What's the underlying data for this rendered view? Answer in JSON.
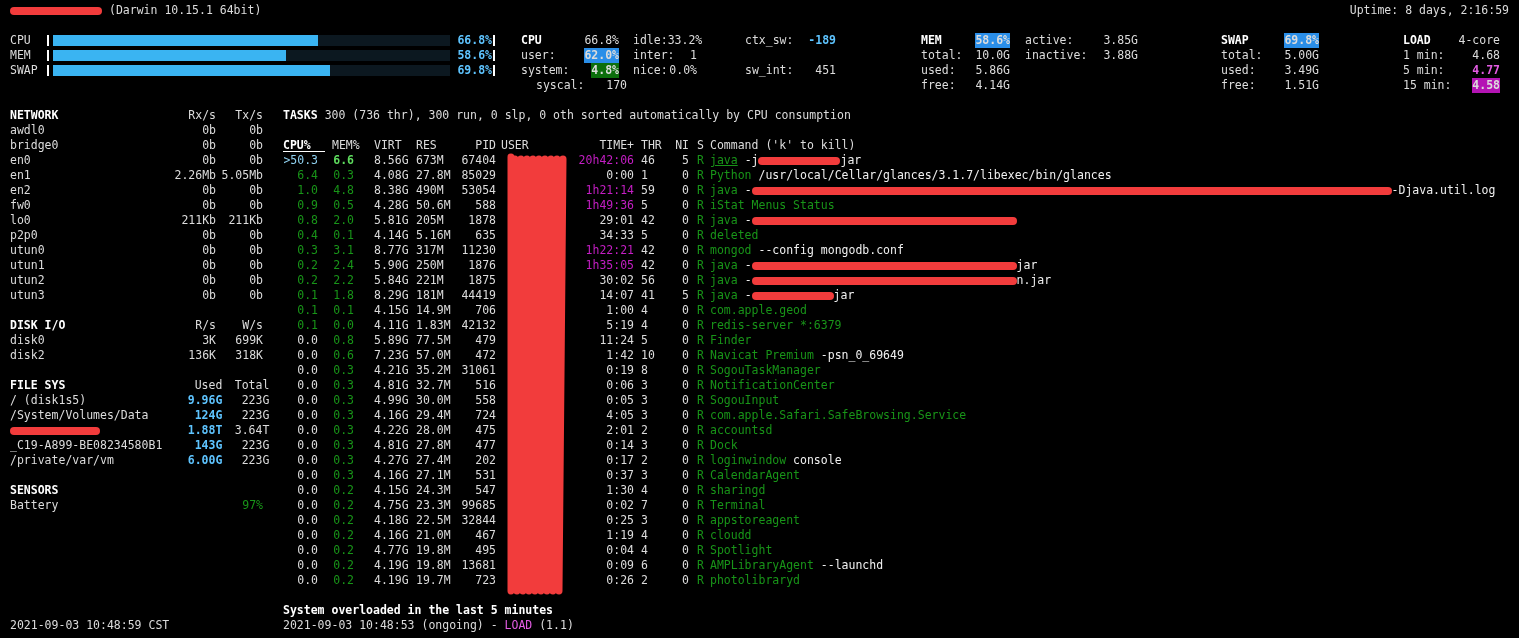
{
  "header": {
    "host_redacted": true,
    "system": "(Darwin 10.15.1 64bit)",
    "uptime": "Uptime: 8 days, 2:16:59"
  },
  "meters": [
    {
      "label": "CPU",
      "level": 0.668,
      "percent": "66.8%"
    },
    {
      "label": "MEM",
      "level": 0.586,
      "percent": "58.6%"
    },
    {
      "label": "SWAP",
      "level": 0.698,
      "percent": "69.8%"
    }
  ],
  "stat_blocks": [
    {
      "kind": "cpu",
      "columns": [
        [
          {
            "label": "CPU",
            "value": "66.8%",
            "title": true,
            "color": "#dcdcdc",
            "filled": false,
            "bold": false
          },
          {
            "label": "user:",
            "value": "62.0%",
            "title": false,
            "color": "#2a8ee8",
            "filled": true,
            "bold": true
          },
          {
            "label": "system:",
            "value": "4.8%",
            "title": false,
            "color": "#0c6e0c",
            "filled": true,
            "bold": true
          }
        ],
        [
          {
            "label": "idle:",
            "value": "33.2%",
            "title": false,
            "color": "#dcdcdc",
            "filled": false,
            "bold": false
          },
          {
            "label": "inter:",
            "value": "1",
            "title": false,
            "color": "#dcdcdc",
            "filled": false,
            "bold": false
          },
          {
            "label": "nice:",
            "value": "0.0%",
            "title": false,
            "color": "#dcdcdc",
            "filled": false,
            "bold": false
          }
        ],
        [
          {
            "label": "ctx_sw:",
            "value": "-189",
            "title": false,
            "color": "#5ec4ff",
            "filled": false,
            "bold": true
          },
          null,
          {
            "label": "sw_int:",
            "value": "451",
            "title": false,
            "color": "#dcdcdc",
            "filled": false,
            "bold": false
          }
        ]
      ],
      "extra": {
        "label": "syscal:",
        "value": "170"
      }
    },
    {
      "kind": "mem",
      "columns": [
        [
          {
            "label": "MEM",
            "value": "58.6%",
            "title": true,
            "color": "#2a8ee8",
            "filled": true,
            "bold": true
          },
          {
            "label": "total:",
            "value": "10.0G",
            "title": false,
            "color": "#dcdcdc",
            "filled": false,
            "bold": false
          },
          {
            "label": "used:",
            "value": "5.86G",
            "title": false,
            "color": "#dcdcdc",
            "filled": false,
            "bold": false
          },
          {
            "label": "free:",
            "value": "4.14G",
            "title": false,
            "color": "#dcdcdc",
            "filled": false,
            "bold": false
          }
        ],
        [
          {
            "label": "active:",
            "value": "3.85G",
            "title": false,
            "color": "#dcdcdc",
            "filled": false,
            "bold": false
          },
          {
            "label": "inactive:",
            "value": "3.88G",
            "title": false,
            "color": "#dcdcdc",
            "filled": false,
            "bold": false
          }
        ]
      ]
    },
    {
      "kind": "swap",
      "columns": [
        [
          {
            "label": "SWAP",
            "value": "69.8%",
            "title": true,
            "color": "#2a8ee8",
            "filled": true,
            "bold": true
          },
          {
            "label": "total:",
            "value": "5.00G",
            "title": false,
            "color": "#dcdcdc",
            "filled": false,
            "bold": false
          },
          {
            "label": "used:",
            "value": "3.49G",
            "title": false,
            "color": "#dcdcdc",
            "filled": false,
            "bold": false
          },
          {
            "label": "free:",
            "value": "1.51G",
            "title": false,
            "color": "#dcdcdc",
            "filled": false,
            "bold": false
          }
        ]
      ]
    },
    {
      "kind": "load",
      "columns": [
        [
          {
            "label": "LOAD",
            "value": "4-core",
            "title": true,
            "color": "#dcdcdc",
            "filled": false,
            "bold": false
          },
          {
            "label": "1 min:",
            "value": "4.68",
            "title": false,
            "color": "#dcdcdc",
            "filled": false,
            "bold": false
          },
          {
            "label": "5 min:",
            "value": "4.77",
            "title": false,
            "color": "#e35ce3",
            "filled": false,
            "bold": true
          },
          {
            "label": "15 min:",
            "value": "4.58",
            "title": false,
            "color": "#b414b4",
            "filled": true,
            "bold": true
          }
        ]
      ]
    }
  ],
  "panels": [
    {
      "title": "NETWORK",
      "headers": [
        "Rx/s",
        "Tx/s"
      ],
      "rows": [
        {
          "name": "awdl0",
          "values": [
            {
              "text": "0b",
              "color": "#dcdcdc",
              "bold": false
            },
            {
              "text": "0b",
              "color": "#dcdcdc",
              "bold": false
            }
          ]
        },
        {
          "name": "bridge0",
          "values": [
            {
              "text": "0b",
              "color": "#dcdcdc",
              "bold": false
            },
            {
              "text": "0b",
              "color": "#dcdcdc",
              "bold": false
            }
          ]
        },
        {
          "name": "en0",
          "values": [
            {
              "text": "0b",
              "color": "#dcdcdc",
              "bold": false
            },
            {
              "text": "0b",
              "color": "#dcdcdc",
              "bold": false
            }
          ]
        },
        {
          "name": "en1",
          "values": [
            {
              "text": "2.26Mb",
              "color": "#dcdcdc",
              "bold": false
            },
            {
              "text": "5.05Mb",
              "color": "#dcdcdc",
              "bold": false
            }
          ]
        },
        {
          "name": "en2",
          "values": [
            {
              "text": "0b",
              "color": "#dcdcdc",
              "bold": false
            },
            {
              "text": "0b",
              "color": "#dcdcdc",
              "bold": false
            }
          ]
        },
        {
          "name": "fw0",
          "values": [
            {
              "text": "0b",
              "color": "#dcdcdc",
              "bold": false
            },
            {
              "text": "0b",
              "color": "#dcdcdc",
              "bold": false
            }
          ]
        },
        {
          "name": "lo0",
          "values": [
            {
              "text": "211Kb",
              "color": "#dcdcdc",
              "bold": false
            },
            {
              "text": "211Kb",
              "color": "#dcdcdc",
              "bold": false
            }
          ]
        },
        {
          "name": "p2p0",
          "values": [
            {
              "text": "0b",
              "color": "#dcdcdc",
              "bold": false
            },
            {
              "text": "0b",
              "color": "#dcdcdc",
              "bold": false
            }
          ]
        },
        {
          "name": "utun0",
          "values": [
            {
              "text": "0b",
              "color": "#dcdcdc",
              "bold": false
            },
            {
              "text": "0b",
              "color": "#dcdcdc",
              "bold": false
            }
          ]
        },
        {
          "name": "utun1",
          "values": [
            {
              "text": "0b",
              "color": "#dcdcdc",
              "bold": false
            },
            {
              "text": "0b",
              "color": "#dcdcdc",
              "bold": false
            }
          ]
        },
        {
          "name": "utun2",
          "values": [
            {
              "text": "0b",
              "color": "#dcdcdc",
              "bold": false
            },
            {
              "text": "0b",
              "color": "#dcdcdc",
              "bold": false
            }
          ]
        },
        {
          "name": "utun3",
          "values": [
            {
              "text": "0b",
              "color": "#dcdcdc",
              "bold": false
            },
            {
              "text": "0b",
              "color": "#dcdcdc",
              "bold": false
            }
          ]
        }
      ]
    },
    {
      "title": "DISK I/O",
      "headers": [
        "R/s",
        "W/s"
      ],
      "rows": [
        {
          "name": "disk0",
          "values": [
            {
              "text": "3K",
              "color": "#dcdcdc",
              "bold": false
            },
            {
              "text": "699K",
              "color": "#dcdcdc",
              "bold": false
            }
          ]
        },
        {
          "name": "disk2",
          "values": [
            {
              "text": "136K",
              "color": "#dcdcdc",
              "bold": false
            },
            {
              "text": "318K",
              "color": "#dcdcdc",
              "bold": false
            }
          ]
        }
      ]
    },
    {
      "title": "FILE SYS",
      "headers": [
        "Used",
        "Total"
      ],
      "rows": [
        {
          "name": "/ (disk1s5)",
          "values": [
            {
              "text": "9.96G",
              "color": "#5ec4ff",
              "bold": true
            },
            {
              "text": "223G",
              "color": "#dcdcdc",
              "bold": false
            }
          ]
        },
        {
          "name": "/System/Volumes/Data",
          "values": [
            {
              "text": "124G",
              "color": "#5ec4ff",
              "bold": true
            },
            {
              "text": "223G",
              "color": "#dcdcdc",
              "bold": false
            }
          ]
        },
        {
          "redacted": true,
          "values": [
            {
              "text": "1.88T",
              "color": "#5ec4ff",
              "bold": true
            },
            {
              "text": "3.64T",
              "color": "#dcdcdc",
              "bold": false
            }
          ]
        },
        {
          "name": "_C19-A899-BE08234580B1",
          "values": [
            {
              "text": "143G",
              "color": "#5ec4ff",
              "bold": true
            },
            {
              "text": "223G",
              "color": "#dcdcdc",
              "bold": false
            }
          ]
        },
        {
          "name": "/private/var/vm",
          "values": [
            {
              "text": "6.00G",
              "color": "#5ec4ff",
              "bold": true
            },
            {
              "text": "223G",
              "color": "#dcdcdc",
              "bold": false
            }
          ]
        }
      ]
    },
    {
      "title": "SENSORS",
      "rows": [
        {
          "name": "Battery",
          "values": [
            {
              "text": "97%",
              "color": "#189418",
              "bold": false
            }
          ]
        }
      ]
    }
  ],
  "footer_time": "2021-09-03 10:48:59 CST",
  "tasks": {
    "title": "TASKS",
    "summary": "300 (736 thr), 300 run, 0 slp, 0 oth sorted automatically by CPU consumption"
  },
  "process_table": {
    "user_redacted": true,
    "columns": [
      {
        "label": "CPU%",
        "sorted": true
      },
      {
        "label": "MEM%",
        "sorted": false
      },
      {
        "label": "VIRT",
        "sorted": false
      },
      {
        "label": "RES",
        "sorted": false
      },
      {
        "label": "PID",
        "sorted": false
      },
      {
        "label": "USER",
        "sorted": false
      },
      {
        "label": "TIME+",
        "sorted": false
      },
      {
        "label": "THR",
        "sorted": false
      },
      {
        "label": "NI",
        "sorted": false
      },
      {
        "label": "S",
        "sorted": false
      },
      {
        "label": "Command ('k' to kill)",
        "sorted": false
      }
    ],
    "rows": [
      {
        "selected": true,
        "cpu": {
          "text": ">50.3",
          "color": "#8fd0ef"
        },
        "mem": {
          "text": "6.6",
          "color": "#5edc5e",
          "bold": true
        },
        "virt": "8.56G",
        "res": "673M",
        "pid": "67404",
        "time": {
          "text": "20h42:06",
          "color": "#c41ec4"
        },
        "thr": "46",
        "ni": "5",
        "status": "R",
        "command": [
          {
            "kind": "name",
            "text": "java"
          },
          {
            "kind": "args",
            "text": "-j"
          },
          {
            "kind": "blot"
          },
          {
            "kind": "tail",
            "text": "jar"
          }
        ]
      },
      {
        "selected": false,
        "cpu": {
          "text": "6.4",
          "color": "#189418"
        },
        "mem": {
          "text": "0.3",
          "color": "#189418",
          "bold": false
        },
        "virt": "4.08G",
        "res": "27.8M",
        "pid": "85029",
        "time": {
          "text": "0:00",
          "color": "#dcdcdc"
        },
        "thr": "1",
        "ni": "0",
        "status": "R",
        "command": [
          {
            "kind": "name",
            "text": "Python"
          },
          {
            "kind": "args",
            "text": "/usr/local/Cellar/glances/3.1.7/libexec/bin/glances"
          }
        ]
      },
      {
        "selected": false,
        "cpu": {
          "text": "1.0",
          "color": "#189418"
        },
        "mem": {
          "text": "4.8",
          "color": "#189418",
          "bold": false
        },
        "virt": "8.38G",
        "res": "490M",
        "pid": "53054",
        "time": {
          "text": "1h21:14",
          "color": "#c41ec4"
        },
        "thr": "59",
        "ni": "0",
        "status": "R",
        "command": [
          {
            "kind": "name",
            "text": "java"
          },
          {
            "kind": "args",
            "text": "-"
          },
          {
            "kind": "strike"
          },
          {
            "kind": "tail",
            "text": "-Djava.util.log"
          }
        ]
      },
      {
        "selected": false,
        "cpu": {
          "text": "0.9",
          "color": "#189418"
        },
        "mem": {
          "text": "0.5",
          "color": "#189418",
          "bold": false
        },
        "virt": "4.28G",
        "res": "50.6M",
        "pid": "588",
        "time": {
          "text": "1h49:36",
          "color": "#c41ec4"
        },
        "thr": "5",
        "ni": "0",
        "status": "R",
        "command": [
          {
            "kind": "name",
            "text": "iStat Menus Status"
          }
        ]
      },
      {
        "selected": false,
        "cpu": {
          "text": "0.8",
          "color": "#189418"
        },
        "mem": {
          "text": "2.0",
          "color": "#189418",
          "bold": false
        },
        "virt": "5.81G",
        "res": "205M",
        "pid": "1878",
        "time": {
          "text": "29:01",
          "color": "#dcdcdc"
        },
        "thr": "42",
        "ni": "0",
        "status": "R",
        "command": [
          {
            "kind": "name",
            "text": "java"
          },
          {
            "kind": "args",
            "text": "-"
          },
          {
            "kind": "smear"
          }
        ]
      },
      {
        "selected": false,
        "cpu": {
          "text": "0.4",
          "color": "#189418"
        },
        "mem": {
          "text": "0.1",
          "color": "#189418",
          "bold": false
        },
        "virt": "4.14G",
        "res": "5.16M",
        "pid": "635",
        "time": {
          "text": "34:33",
          "color": "#dcdcdc"
        },
        "thr": "5",
        "ni": "0",
        "status": "R",
        "command": [
          {
            "kind": "name",
            "text": "deleted"
          }
        ]
      },
      {
        "selected": false,
        "cpu": {
          "text": "0.3",
          "color": "#189418"
        },
        "mem": {
          "text": "3.1",
          "color": "#189418",
          "bold": false
        },
        "virt": "8.77G",
        "res": "317M",
        "pid": "11230",
        "time": {
          "text": "1h22:21",
          "color": "#c41ec4"
        },
        "thr": "42",
        "ni": "0",
        "status": "R",
        "command": [
          {
            "kind": "name",
            "text": "mongod"
          },
          {
            "kind": "args",
            "text": "--config mongodb.conf"
          }
        ]
      },
      {
        "selected": false,
        "cpu": {
          "text": "0.2",
          "color": "#189418"
        },
        "mem": {
          "text": "2.4",
          "color": "#189418",
          "bold": false
        },
        "virt": "5.90G",
        "res": "250M",
        "pid": "1876",
        "time": {
          "text": "1h35:05",
          "color": "#c41ec4"
        },
        "thr": "42",
        "ni": "0",
        "status": "R",
        "command": [
          {
            "kind": "name",
            "text": "java"
          },
          {
            "kind": "args",
            "text": "-"
          },
          {
            "kind": "smear"
          },
          {
            "kind": "tail",
            "text": "jar"
          }
        ]
      },
      {
        "selected": false,
        "cpu": {
          "text": "0.2",
          "color": "#189418"
        },
        "mem": {
          "text": "2.2",
          "color": "#189418",
          "bold": false
        },
        "virt": "5.84G",
        "res": "221M",
        "pid": "1875",
        "time": {
          "text": "30:02",
          "color": "#dcdcdc"
        },
        "thr": "56",
        "ni": "0",
        "status": "R",
        "command": [
          {
            "kind": "name",
            "text": "java"
          },
          {
            "kind": "args",
            "text": "-"
          },
          {
            "kind": "smear"
          },
          {
            "kind": "tail",
            "text": "n.jar"
          }
        ]
      },
      {
        "selected": false,
        "cpu": {
          "text": "0.1",
          "color": "#189418"
        },
        "mem": {
          "text": "1.8",
          "color": "#189418",
          "bold": false
        },
        "virt": "8.29G",
        "res": "181M",
        "pid": "44419",
        "time": {
          "text": "14:07",
          "color": "#dcdcdc"
        },
        "thr": "41",
        "ni": "5",
        "status": "R",
        "command": [
          {
            "kind": "name",
            "text": "java"
          },
          {
            "kind": "args",
            "text": "-"
          },
          {
            "kind": "blot"
          },
          {
            "kind": "tail",
            "text": "jar"
          }
        ]
      },
      {
        "selected": false,
        "cpu": {
          "text": "0.1",
          "color": "#189418"
        },
        "mem": {
          "text": "0.1",
          "color": "#189418",
          "bold": false
        },
        "virt": "4.15G",
        "res": "14.9M",
        "pid": "706",
        "time": {
          "text": "1:00",
          "color": "#dcdcdc"
        },
        "thr": "4",
        "ni": "0",
        "status": "R",
        "command": [
          {
            "kind": "name",
            "text": "com.apple.geod"
          }
        ]
      },
      {
        "selected": false,
        "cpu": {
          "text": "0.1",
          "color": "#189418"
        },
        "mem": {
          "text": "0.0",
          "color": "#189418",
          "bold": false
        },
        "virt": "4.11G",
        "res": "1.83M",
        "pid": "42132",
        "time": {
          "text": "5:19",
          "color": "#dcdcdc"
        },
        "thr": "4",
        "ni": "0",
        "status": "R",
        "command": [
          {
            "kind": "name",
            "text": "redis-server *:6379"
          }
        ]
      },
      {
        "selected": false,
        "cpu": {
          "text": "0.0",
          "color": "#dcdcdc"
        },
        "mem": {
          "text": "0.8",
          "color": "#189418",
          "bold": false
        },
        "virt": "5.89G",
        "res": "77.5M",
        "pid": "479",
        "time": {
          "text": "11:24",
          "color": "#dcdcdc"
        },
        "thr": "5",
        "ni": "0",
        "status": "R",
        "command": [
          {
            "kind": "name",
            "text": "Finder"
          }
        ]
      },
      {
        "selected": false,
        "cpu": {
          "text": "0.0",
          "color": "#dcdcdc"
        },
        "mem": {
          "text": "0.6",
          "color": "#189418",
          "bold": false
        },
        "virt": "7.23G",
        "res": "57.0M",
        "pid": "472",
        "time": {
          "text": "1:42",
          "color": "#dcdcdc"
        },
        "thr": "10",
        "ni": "0",
        "status": "R",
        "command": [
          {
            "kind": "name",
            "text": "Navicat Premium"
          },
          {
            "kind": "args",
            "text": "-psn_0_69649"
          }
        ]
      },
      {
        "selected": false,
        "cpu": {
          "text": "0.0",
          "color": "#dcdcdc"
        },
        "mem": {
          "text": "0.3",
          "color": "#189418",
          "bold": false
        },
        "virt": "4.21G",
        "res": "35.2M",
        "pid": "31061",
        "time": {
          "text": "0:19",
          "color": "#dcdcdc"
        },
        "thr": "8",
        "ni": "0",
        "status": "R",
        "command": [
          {
            "kind": "name",
            "text": "SogouTaskManager"
          }
        ]
      },
      {
        "selected": false,
        "cpu": {
          "text": "0.0",
          "color": "#dcdcdc"
        },
        "mem": {
          "text": "0.3",
          "color": "#189418",
          "bold": false
        },
        "virt": "4.81G",
        "res": "32.7M",
        "pid": "516",
        "time": {
          "text": "0:06",
          "color": "#dcdcdc"
        },
        "thr": "3",
        "ni": "0",
        "status": "R",
        "command": [
          {
            "kind": "name",
            "text": "NotificationCenter"
          }
        ]
      },
      {
        "selected": false,
        "cpu": {
          "text": "0.0",
          "color": "#dcdcdc"
        },
        "mem": {
          "text": "0.3",
          "color": "#189418",
          "bold": false
        },
        "virt": "4.99G",
        "res": "30.0M",
        "pid": "558",
        "time": {
          "text": "0:05",
          "color": "#dcdcdc"
        },
        "thr": "3",
        "ni": "0",
        "status": "R",
        "command": [
          {
            "kind": "name",
            "text": "SogouInput"
          }
        ]
      },
      {
        "selected": false,
        "cpu": {
          "text": "0.0",
          "color": "#dcdcdc"
        },
        "mem": {
          "text": "0.3",
          "color": "#189418",
          "bold": false
        },
        "virt": "4.16G",
        "res": "29.4M",
        "pid": "724",
        "time": {
          "text": "4:05",
          "color": "#dcdcdc"
        },
        "thr": "3",
        "ni": "0",
        "status": "R",
        "command": [
          {
            "kind": "name",
            "text": "com.apple.Safari.SafeBrowsing.Service"
          }
        ]
      },
      {
        "selected": false,
        "cpu": {
          "text": "0.0",
          "color": "#dcdcdc"
        },
        "mem": {
          "text": "0.3",
          "color": "#189418",
          "bold": false
        },
        "virt": "4.22G",
        "res": "28.0M",
        "pid": "475",
        "time": {
          "text": "2:01",
          "color": "#dcdcdc"
        },
        "thr": "2",
        "ni": "0",
        "status": "R",
        "command": [
          {
            "kind": "name",
            "text": "accountsd"
          }
        ]
      },
      {
        "selected": false,
        "cpu": {
          "text": "0.0",
          "color": "#dcdcdc"
        },
        "mem": {
          "text": "0.3",
          "color": "#189418",
          "bold": false
        },
        "virt": "4.81G",
        "res": "27.8M",
        "pid": "477",
        "time": {
          "text": "0:14",
          "color": "#dcdcdc"
        },
        "thr": "3",
        "ni": "0",
        "status": "R",
        "command": [
          {
            "kind": "name",
            "text": "Dock"
          }
        ]
      },
      {
        "selected": false,
        "cpu": {
          "text": "0.0",
          "color": "#dcdcdc"
        },
        "mem": {
          "text": "0.3",
          "color": "#189418",
          "bold": false
        },
        "virt": "4.27G",
        "res": "27.4M",
        "pid": "202",
        "time": {
          "text": "0:17",
          "color": "#dcdcdc"
        },
        "thr": "2",
        "ni": "0",
        "status": "R",
        "command": [
          {
            "kind": "name",
            "text": "loginwindow"
          },
          {
            "kind": "args",
            "text": "console"
          }
        ]
      },
      {
        "selected": false,
        "cpu": {
          "text": "0.0",
          "color": "#dcdcdc"
        },
        "mem": {
          "text": "0.3",
          "color": "#189418",
          "bold": false
        },
        "virt": "4.16G",
        "res": "27.1M",
        "pid": "531",
        "time": {
          "text": "0:37",
          "color": "#dcdcdc"
        },
        "thr": "3",
        "ni": "0",
        "status": "R",
        "command": [
          {
            "kind": "name",
            "text": "CalendarAgent"
          }
        ]
      },
      {
        "selected": false,
        "cpu": {
          "text": "0.0",
          "color": "#dcdcdc"
        },
        "mem": {
          "text": "0.2",
          "color": "#189418",
          "bold": false
        },
        "virt": "4.15G",
        "res": "24.3M",
        "pid": "547",
        "time": {
          "text": "1:30",
          "color": "#dcdcdc"
        },
        "thr": "4",
        "ni": "0",
        "status": "R",
        "command": [
          {
            "kind": "name",
            "text": "sharingd"
          }
        ]
      },
      {
        "selected": false,
        "cpu": {
          "text": "0.0",
          "color": "#dcdcdc"
        },
        "mem": {
          "text": "0.2",
          "color": "#189418",
          "bold": false
        },
        "virt": "4.75G",
        "res": "23.3M",
        "pid": "99685",
        "time": {
          "text": "0:02",
          "color": "#dcdcdc"
        },
        "thr": "7",
        "ni": "0",
        "status": "R",
        "command": [
          {
            "kind": "name",
            "text": "Terminal"
          }
        ]
      },
      {
        "selected": false,
        "cpu": {
          "text": "0.0",
          "color": "#dcdcdc"
        },
        "mem": {
          "text": "0.2",
          "color": "#189418",
          "bold": false
        },
        "virt": "4.18G",
        "res": "22.5M",
        "pid": "32844",
        "time": {
          "text": "0:25",
          "color": "#dcdcdc"
        },
        "thr": "3",
        "ni": "0",
        "status": "R",
        "command": [
          {
            "kind": "name",
            "text": "appstoreagent"
          }
        ]
      },
      {
        "selected": false,
        "cpu": {
          "text": "0.0",
          "color": "#dcdcdc"
        },
        "mem": {
          "text": "0.2",
          "color": "#189418",
          "bold": false
        },
        "virt": "4.16G",
        "res": "21.0M",
        "pid": "467",
        "time": {
          "text": "1:19",
          "color": "#dcdcdc"
        },
        "thr": "4",
        "ni": "0",
        "status": "R",
        "command": [
          {
            "kind": "name",
            "text": "cloudd"
          }
        ]
      },
      {
        "selected": false,
        "cpu": {
          "text": "0.0",
          "color": "#dcdcdc"
        },
        "mem": {
          "text": "0.2",
          "color": "#189418",
          "bold": false
        },
        "virt": "4.77G",
        "res": "19.8M",
        "pid": "495",
        "time": {
          "text": "0:04",
          "color": "#dcdcdc"
        },
        "thr": "4",
        "ni": "0",
        "status": "R",
        "command": [
          {
            "kind": "name",
            "text": "Spotlight"
          }
        ]
      },
      {
        "selected": false,
        "cpu": {
          "text": "0.0",
          "color": "#dcdcdc"
        },
        "mem": {
          "text": "0.2",
          "color": "#189418",
          "bold": false
        },
        "virt": "4.19G",
        "res": "19.8M",
        "pid": "13681",
        "time": {
          "text": "0:09",
          "color": "#dcdcdc"
        },
        "thr": "6",
        "ni": "0",
        "status": "R",
        "command": [
          {
            "kind": "name",
            "text": "AMPLibraryAgent"
          },
          {
            "kind": "args",
            "text": "--launchd"
          }
        ]
      },
      {
        "selected": false,
        "cpu": {
          "text": "0.0",
          "color": "#dcdcdc"
        },
        "mem": {
          "text": "0.2",
          "color": "#189418",
          "bold": false
        },
        "virt": "4.19G",
        "res": "19.7M",
        "pid": "723",
        "time": {
          "text": "0:26",
          "color": "#dcdcdc"
        },
        "thr": "2",
        "ni": "0",
        "status": "R",
        "command": [
          {
            "kind": "name",
            "text": "photolibraryd"
          }
        ]
      }
    ]
  },
  "alert": {
    "title": "System overloaded in the last 5 minutes",
    "time": "2021-09-03 10:48:53 (ongoing) -",
    "type": "LOAD",
    "value": "(1.1)"
  }
}
